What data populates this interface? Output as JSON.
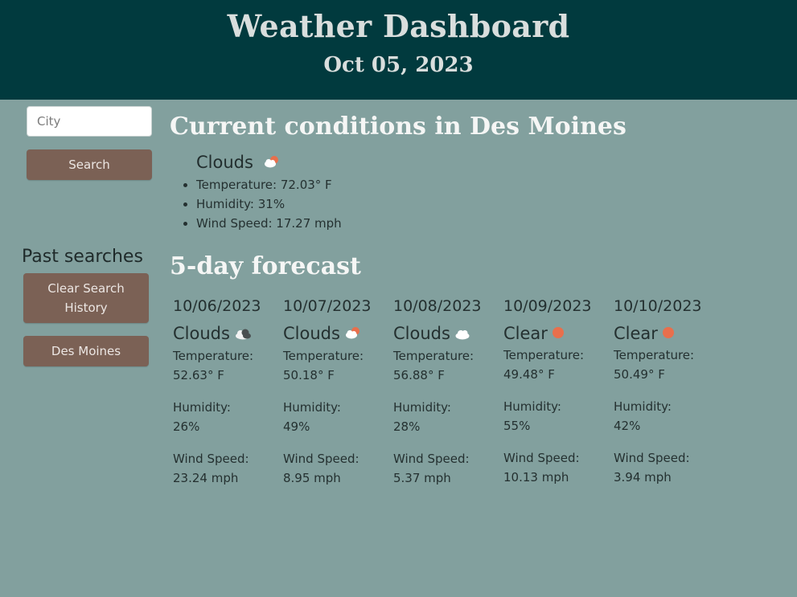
{
  "header": {
    "title": "Weather Dashboard",
    "date": "Oct 05, 2023"
  },
  "sidebar": {
    "city_placeholder": "City",
    "search_label": "Search",
    "past_searches_title": "Past searches",
    "clear_history_label": "Clear Search History",
    "history": [
      "Des Moines"
    ]
  },
  "current": {
    "title": "Current conditions in Des Moines",
    "condition": "Clouds",
    "icon": "cloud-sun-icon",
    "temperature": "Temperature: 72.03° F",
    "humidity": "Humidity: 31%",
    "wind": "Wind Speed: 17.27 mph"
  },
  "forecast": {
    "title": "5-day forecast",
    "temperature_label": "Temperature:",
    "humidity_label": "Humidity:",
    "wind_label": "Wind Speed:",
    "days": [
      {
        "date": "10/06/2023",
        "condition": "Clouds",
        "icon": "dark-cloud-icon",
        "temperature": "52.63° F",
        "humidity": "26%",
        "wind": "23.24 mph"
      },
      {
        "date": "10/07/2023",
        "condition": "Clouds",
        "icon": "cloud-sun-icon",
        "temperature": "50.18° F",
        "humidity": "49%",
        "wind": "8.95 mph"
      },
      {
        "date": "10/08/2023",
        "condition": "Clouds",
        "icon": "white-cloud-icon",
        "temperature": "56.88° F",
        "humidity": "28%",
        "wind": "5.37 mph"
      },
      {
        "date": "10/09/2023",
        "condition": "Clear",
        "icon": "sun-icon",
        "temperature": "49.48° F",
        "humidity": "55%",
        "wind": "10.13 mph"
      },
      {
        "date": "10/10/2023",
        "condition": "Clear",
        "icon": "sun-icon",
        "temperature": "50.49° F",
        "humidity": "42%",
        "wind": "3.94 mph"
      }
    ]
  },
  "colors": {
    "header_bg": "#013a3e",
    "page_bg": "#82a09e",
    "button_bg": "#7b6155",
    "sun": "#e86f4c"
  }
}
